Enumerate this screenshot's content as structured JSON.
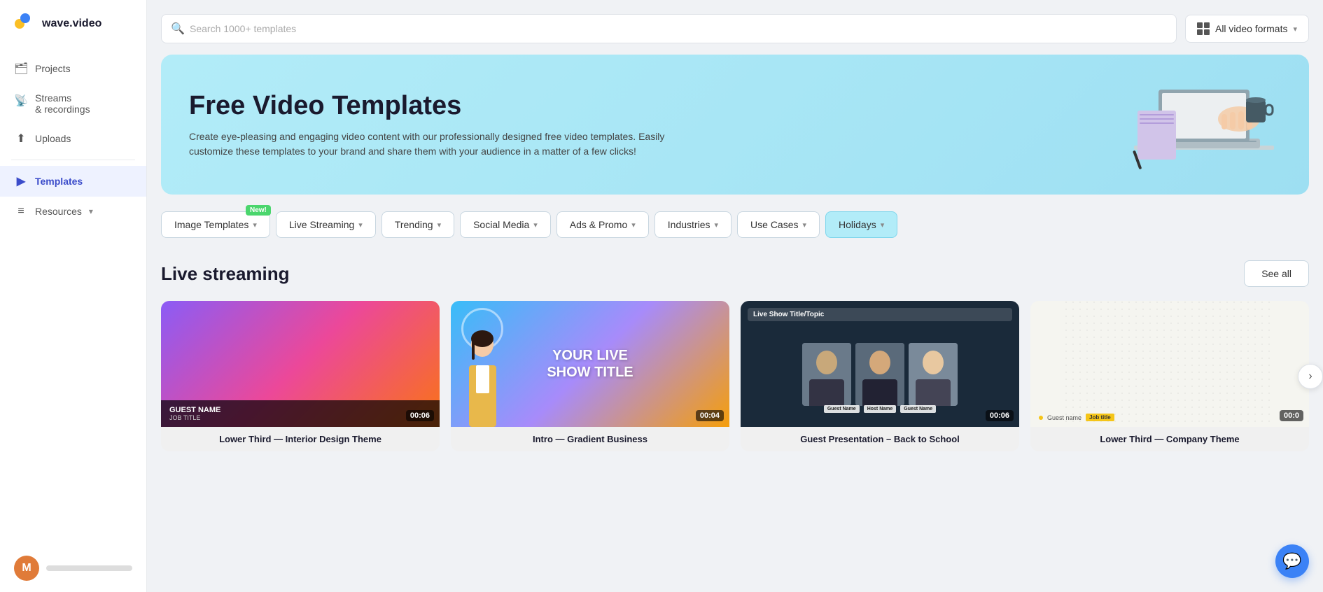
{
  "app": {
    "logo_text": "wave.video",
    "logo_emoji": "🌊"
  },
  "sidebar": {
    "items": [
      {
        "id": "projects",
        "label": "Projects",
        "icon": "🗂"
      },
      {
        "id": "streams",
        "label": "Streams\n& recordings",
        "icon": "📡"
      },
      {
        "id": "uploads",
        "label": "Uploads",
        "icon": "⬆"
      },
      {
        "id": "templates",
        "label": "Templates",
        "icon": "▶",
        "active": true
      },
      {
        "id": "resources",
        "label": "Resources",
        "icon": "≡",
        "hasChevron": true
      }
    ],
    "avatar_initial": "M"
  },
  "search": {
    "placeholder": "Search 1000+ templates"
  },
  "format_dropdown": {
    "label": "All video formats"
  },
  "hero": {
    "title": "Free Video Templates",
    "description": "Create eye-pleasing and engaging video content with our professionally designed free video templates. Easily customize these templates to your brand and share them with your audience in a matter of a few clicks!"
  },
  "filter_tabs": [
    {
      "id": "image-templates",
      "label": "Image Templates",
      "hasChevron": true,
      "isNew": true
    },
    {
      "id": "live-streaming",
      "label": "Live Streaming",
      "hasChevron": true
    },
    {
      "id": "trending",
      "label": "Trending",
      "hasChevron": true
    },
    {
      "id": "social-media",
      "label": "Social Media",
      "hasChevron": true
    },
    {
      "id": "ads-promo",
      "label": "Ads & Promo",
      "hasChevron": true
    },
    {
      "id": "industries",
      "label": "Industries",
      "hasChevron": true
    },
    {
      "id": "use-cases",
      "label": "Use Cases",
      "hasChevron": true
    },
    {
      "id": "holidays",
      "label": "Holidays",
      "hasChevron": true
    }
  ],
  "new_badge_label": "New!",
  "section": {
    "title": "Live streaming",
    "see_all_label": "See all"
  },
  "cards": [
    {
      "id": "card-1",
      "label": "Lower Third — Interior Design Theme",
      "duration": "00:06",
      "guest_name": "GUEST NAME",
      "job_title": "JOB TITLE"
    },
    {
      "id": "card-2",
      "label": "Intro — Gradient Business",
      "duration": "00:04",
      "title_text": "YOUR LIVE\nSHOW TITLE"
    },
    {
      "id": "card-3",
      "label": "Guest Presentation – Back to School",
      "duration": "00:06",
      "show_title": "Live Show Title/Topic",
      "names": [
        "Guest Name",
        "Host Name",
        "Guest Name"
      ]
    },
    {
      "id": "card-4",
      "label": "Lower Third — Company Theme",
      "duration": "00:0",
      "guest_text": "Guest name",
      "job_badge": "Job title"
    }
  ]
}
